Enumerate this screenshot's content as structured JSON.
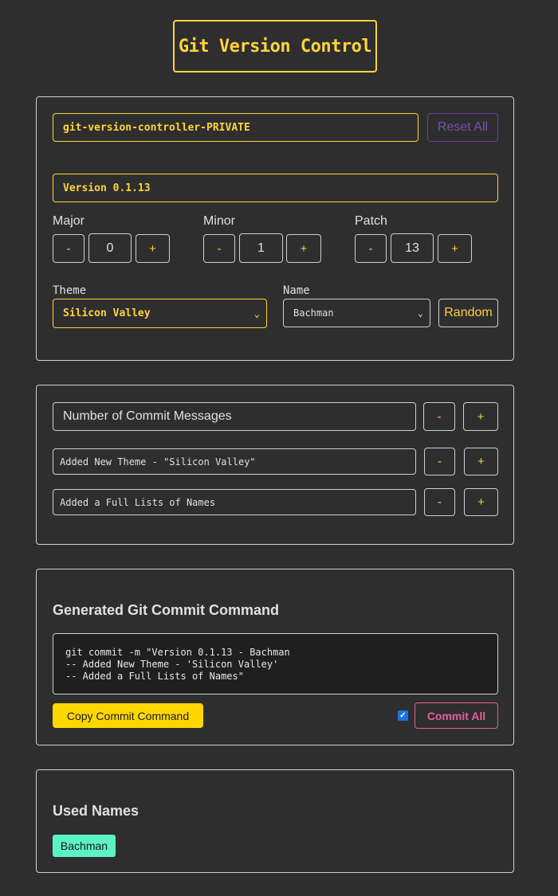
{
  "app": {
    "title": "Git Version Control"
  },
  "repo": {
    "name": "git-version-controller-PRIVATE",
    "reset_label": "Reset All"
  },
  "version": {
    "display": "Version 0.1.13",
    "major": {
      "label": "Major",
      "value": "0"
    },
    "minor": {
      "label": "Minor",
      "value": "1"
    },
    "patch": {
      "label": "Patch",
      "value": "13"
    },
    "decrement_label": "-",
    "increment_label": "+"
  },
  "theme": {
    "label": "Theme",
    "selected": "Silicon Valley"
  },
  "name": {
    "label": "Name",
    "selected": "Bachman",
    "random_label": "Random"
  },
  "messages": {
    "count_label": "Number of Commit Messages",
    "items": [
      "Added New Theme - \"Silicon Valley\"",
      "Added a Full Lists of Names"
    ]
  },
  "command": {
    "heading": "Generated Git Commit Command",
    "text": "git commit -m \"Version 0.1.13 - Bachman\n-- Added New Theme - 'Silicon Valley'\n-- Added a Full Lists of Names\"",
    "copy_label": "Copy Commit Command",
    "commit_all_label": "Commit All",
    "commit_all_checked": true
  },
  "used_names": {
    "heading": "Used Names",
    "names": [
      "Bachman"
    ]
  },
  "colors": {
    "accent": "#ffd43b",
    "commit": "#e0609a",
    "tag": "#5cf2c4",
    "reset": "#7a4fb5"
  }
}
